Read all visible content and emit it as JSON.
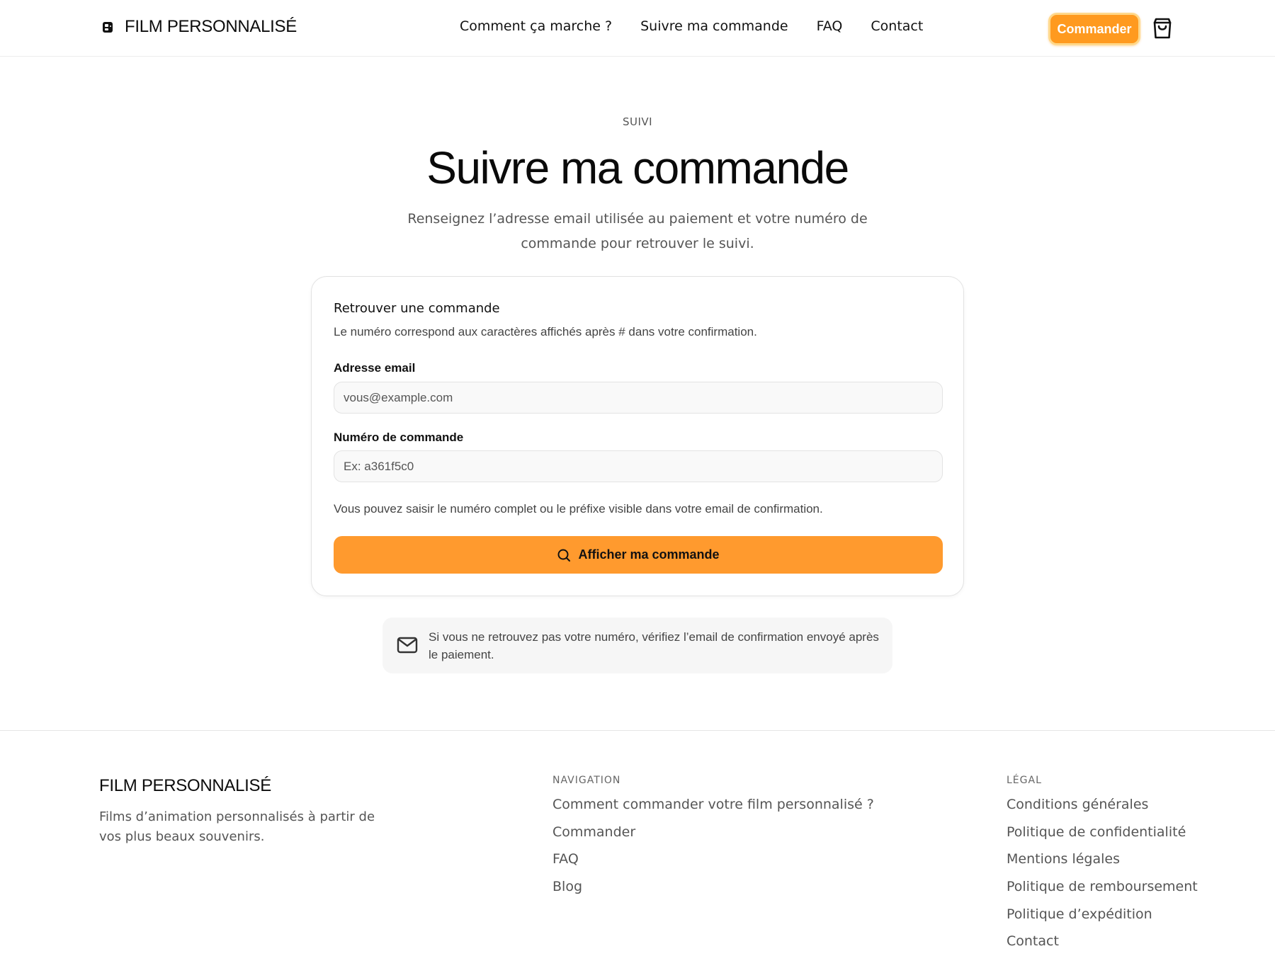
{
  "header": {
    "brand": "FILM PERSONNALISÉ",
    "nav": [
      "Comment ça marche ?",
      "Suivre ma commande",
      "FAQ",
      "Contact"
    ],
    "cta": "Commander",
    "accent": "#ff9a1f"
  },
  "hero": {
    "eyebrow": "SUIVI",
    "title": "Suivre ma commande",
    "subtitle": "Renseignez l’adresse email utilisée au paiement et votre numéro de commande pour retrouver le suivi."
  },
  "form": {
    "title": "Retrouver une commande",
    "description": "Le numéro correspond aux caractères affichés après # dans votre confirmation.",
    "email_label": "Adresse email",
    "email_placeholder": "vous@example.com",
    "order_label": "Numéro de commande",
    "order_placeholder": "Ex: a361f5c0",
    "help": "Vous pouvez saisir le numéro complet ou le préfixe visible dans votre email de confirmation.",
    "submit": "Afficher ma commande"
  },
  "note": {
    "text": "Si vous ne retrouvez pas votre numéro, vérifiez l’email de confirmation envoyé après le paiement."
  },
  "footer": {
    "brand": "FILM PERSONNALISÉ",
    "tagline": "Films d’animation personnalisés à partir de vos plus beaux souvenirs.",
    "nav_title": "NAVIGATION",
    "nav_links": [
      "Comment commander votre film personnalisé ?",
      "Commander",
      "FAQ",
      "Blog"
    ],
    "legal_title": "LÉGAL",
    "legal_links": [
      "Conditions générales",
      "Politique de confidentialité",
      "Mentions légales",
      "Politique de remboursement",
      "Politique d’expédition",
      "Contact"
    ]
  }
}
